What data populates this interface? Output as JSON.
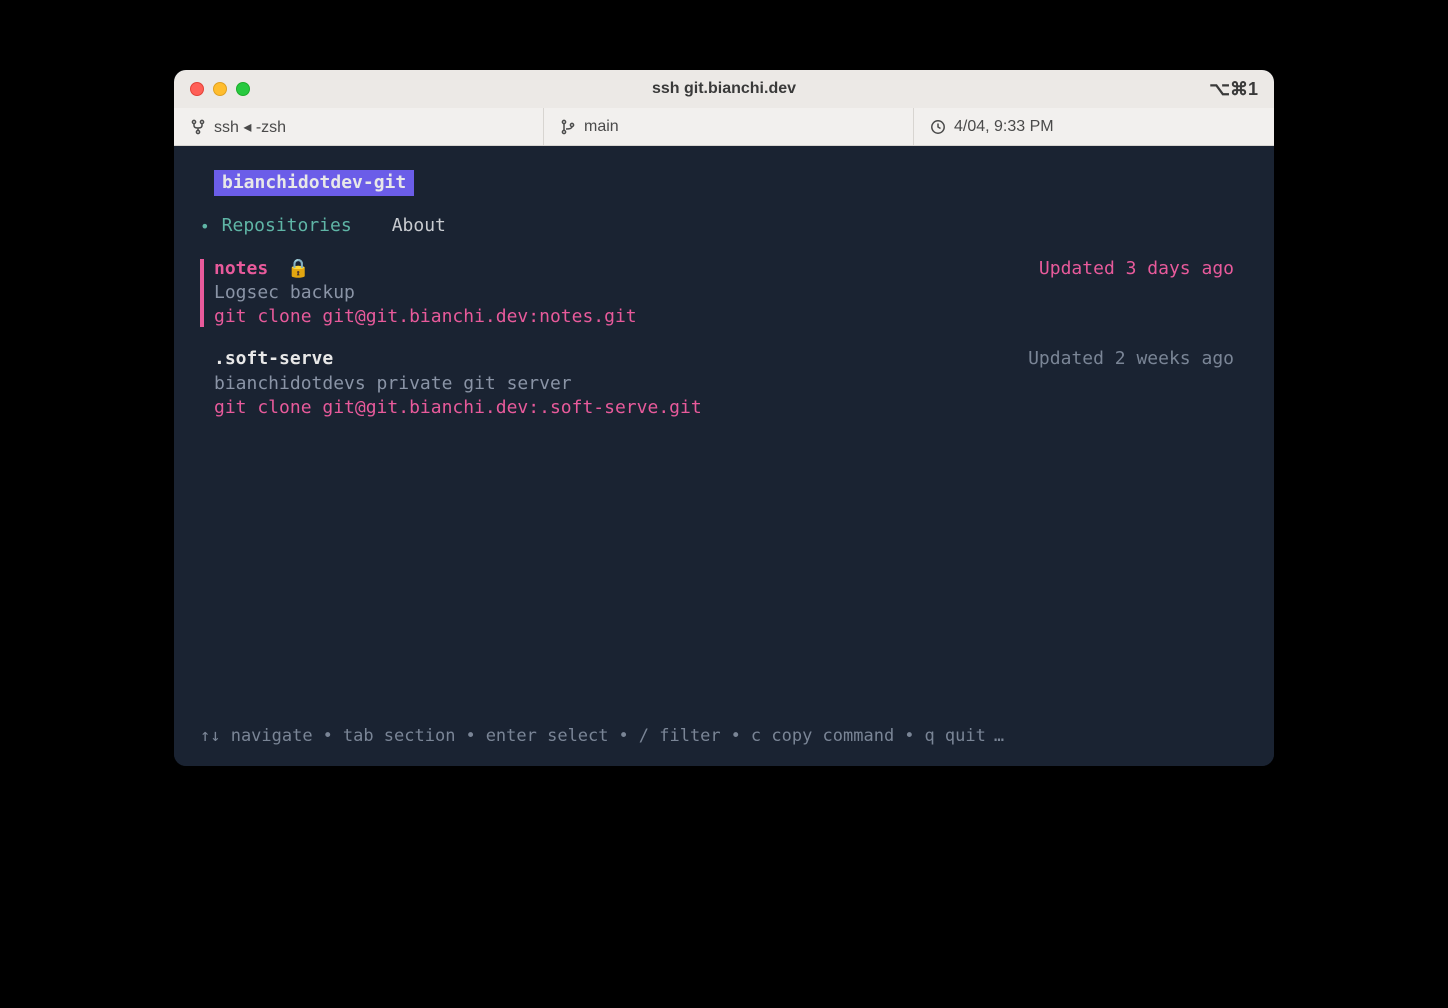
{
  "window": {
    "title": "ssh git.bianchi.dev",
    "shortcut_indicator": "⌥⌘1"
  },
  "statusbar": {
    "process": "ssh ◂ -zsh",
    "branch": "main",
    "datetime": "4/04, 9:33 PM"
  },
  "server": {
    "name": "bianchidotdev-git"
  },
  "tabs": [
    {
      "label": "Repositories",
      "active": true
    },
    {
      "label": "About",
      "active": false
    }
  ],
  "repos": [
    {
      "name": "notes",
      "private": true,
      "lock_icon": "🔒",
      "description": "Logsec backup",
      "clone_cmd": "git clone git@git.bianchi.dev:notes.git",
      "updated": "Updated 3 days ago",
      "selected": true
    },
    {
      "name": ".soft-serve",
      "private": false,
      "lock_icon": "",
      "description": "bianchidotdevs private git server",
      "clone_cmd": "git clone git@git.bianchi.dev:.soft-serve.git",
      "updated": "Updated 2 weeks ago",
      "selected": false
    }
  ],
  "help": {
    "navigate": "↑↓ navigate",
    "tab": "tab section",
    "enter": "enter select",
    "filter": "/ filter",
    "copy": "c copy command",
    "quit": "q quit",
    "more": "…",
    "sep": "•"
  }
}
